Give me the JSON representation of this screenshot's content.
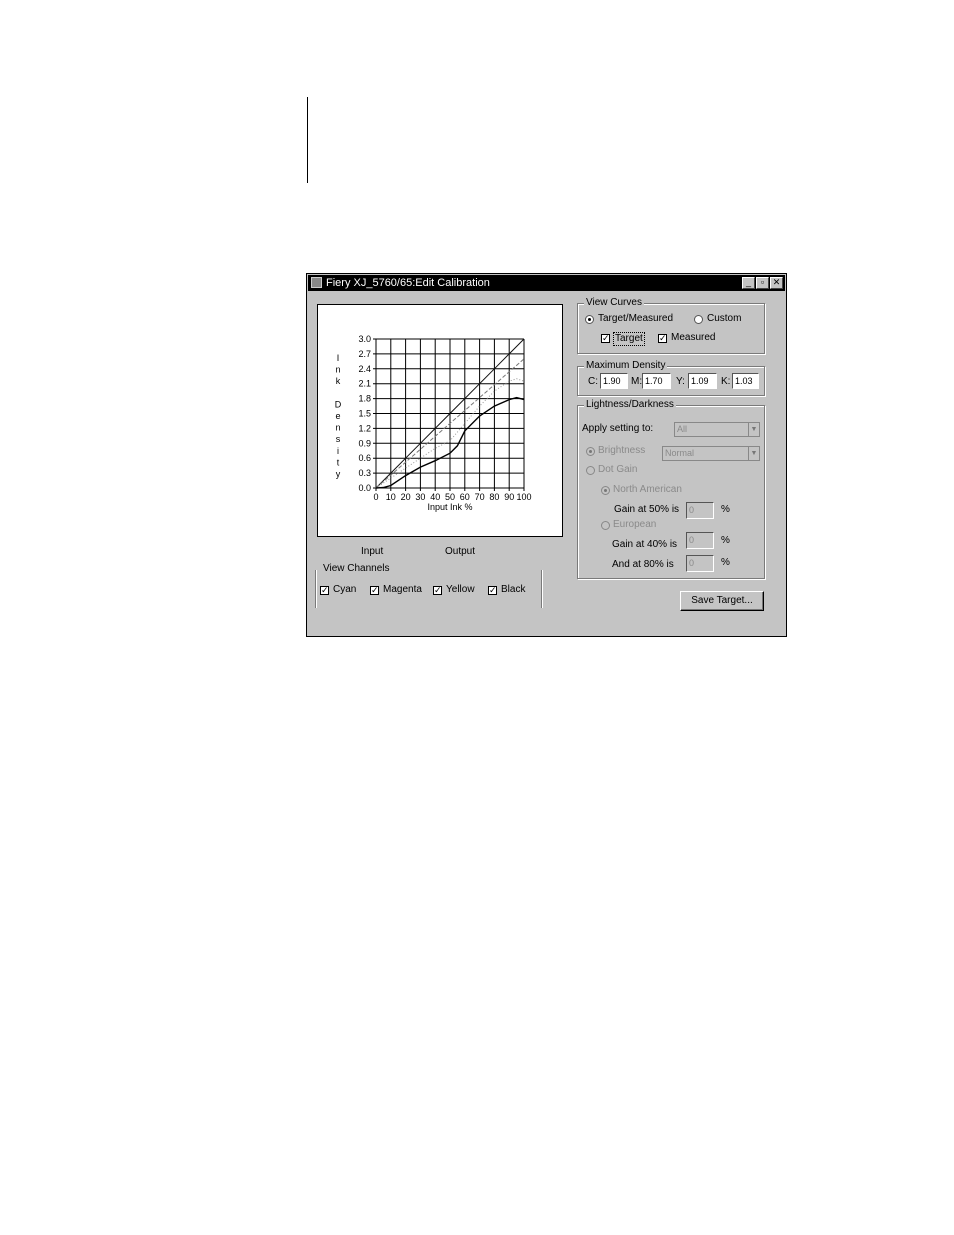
{
  "window": {
    "title": "Fiery XJ_5760/65:Edit Calibration",
    "title_buttons": [
      "_",
      "▫",
      "✕"
    ]
  },
  "chart_data": {
    "type": "line",
    "xlabel": "Input Ink %",
    "ylabel": "Ink Density",
    "ylabel_chars": [
      "I",
      "n",
      "k",
      "",
      "D",
      "e",
      "n",
      "s",
      "i",
      "t",
      "y"
    ],
    "x_ticks": [
      "0",
      "10",
      "20",
      "30",
      "40",
      "50",
      "60",
      "70",
      "80",
      "90",
      "100"
    ],
    "y_ticks": [
      "3.0",
      "2.7",
      "2.4",
      "2.1",
      "1.8",
      "1.5",
      "1.2",
      "0.9",
      "0.6",
      "0.3",
      "0.0"
    ],
    "xlim": [
      0,
      100
    ],
    "ylim": [
      0,
      3.0
    ],
    "grid": true,
    "series": [
      {
        "x": [
          0,
          10,
          20,
          30,
          40,
          50,
          60,
          70,
          80,
          90,
          100
        ],
        "y": [
          0,
          0.3,
          0.6,
          0.9,
          1.2,
          1.5,
          1.8,
          2.1,
          2.4,
          2.7,
          3.0
        ],
        "color": "#111111",
        "dash": ""
      },
      {
        "x": [
          0,
          10,
          20,
          30,
          40,
          50,
          60,
          70,
          80,
          90,
          100
        ],
        "y": [
          0,
          0.26,
          0.52,
          0.78,
          1.04,
          1.3,
          1.56,
          1.82,
          2.08,
          2.34,
          2.6
        ],
        "color": "#777777",
        "dash": "4,2"
      },
      {
        "x": [
          0,
          10,
          20,
          30,
          40,
          50,
          60,
          70,
          80,
          90,
          95,
          100
        ],
        "y": [
          0,
          0.2,
          0.4,
          0.6,
          0.8,
          0.95,
          1.3,
          1.65,
          1.95,
          2.15,
          2.2,
          2.15
        ],
        "color": "#999999",
        "dash": "1,2"
      },
      {
        "x": [
          0,
          5,
          10,
          20,
          30,
          40,
          50,
          55,
          60,
          70,
          80,
          90,
          95,
          100
        ],
        "y": [
          0,
          0.01,
          0.05,
          0.25,
          0.42,
          0.55,
          0.7,
          0.85,
          1.15,
          1.45,
          1.65,
          1.78,
          1.82,
          1.78
        ],
        "color": "#000000",
        "dash": ""
      }
    ]
  },
  "io_labels": {
    "input": "Input",
    "output": "Output"
  },
  "view_channels": {
    "title": "View Channels",
    "items": [
      {
        "label": "Cyan",
        "checked": true
      },
      {
        "label": "Magenta",
        "checked": true
      },
      {
        "label": "Yellow",
        "checked": true
      },
      {
        "label": "Black",
        "checked": true
      }
    ]
  },
  "view_curves": {
    "title": "View Curves",
    "target_measured": "Target/Measured",
    "custom": "Custom",
    "target": "Target",
    "measured": "Measured"
  },
  "max_density": {
    "title": "Maximum Density",
    "c_label": "C:",
    "c_value": "1.90",
    "m_label": "M:",
    "m_value": "1.70",
    "y_label": "Y:",
    "y_value": "1.09",
    "k_label": "K:",
    "k_value": "1.03"
  },
  "lightness": {
    "title": "Lightness/Darkness",
    "apply_label": "Apply setting to:",
    "apply_value": "All",
    "brightness_label": "Brightness",
    "brightness_value": "Normal",
    "dot_gain_label": "Dot Gain",
    "north_american_label": "North American",
    "gain50_label": "Gain at 50% is",
    "gain50_value": "0",
    "european_label": "European",
    "gain40_label": "Gain at 40% is",
    "gain40_value": "0",
    "and80_label": "And at 80% is",
    "and80_value": "0",
    "pct": "%"
  },
  "save_button": "Save Target..."
}
